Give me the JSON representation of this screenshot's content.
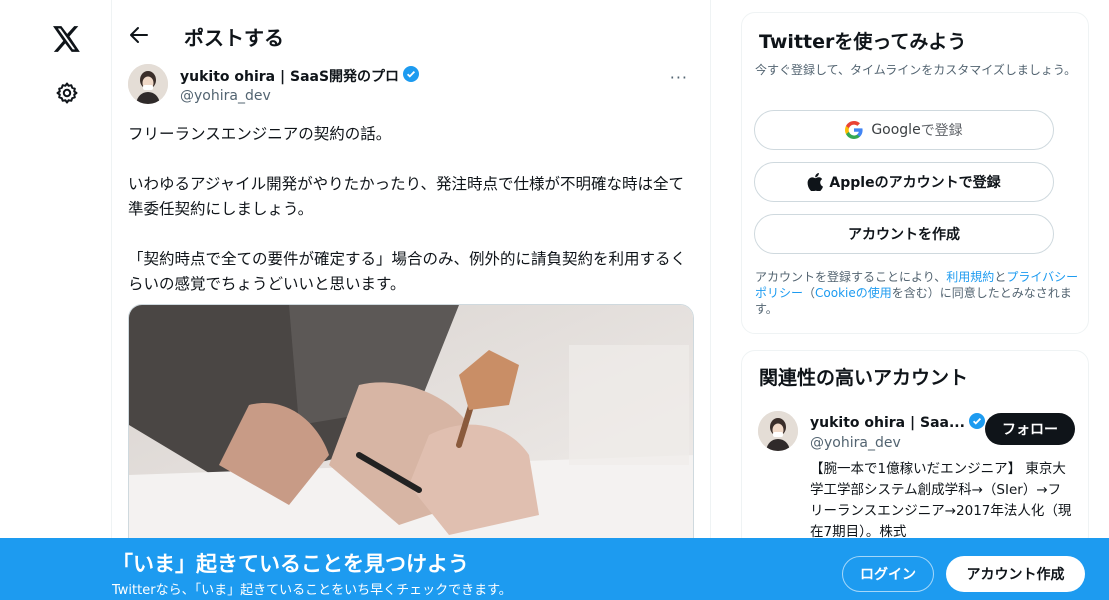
{
  "header": {
    "title": "ポストする"
  },
  "tweet": {
    "author_name": "yukito ohira | SaaS開発のプロ",
    "author_handle": "@yohira_dev",
    "more_label": "···",
    "text": "フリーランスエンジニアの契約の話。\n\nいわゆるアジャイル開発がやりたかったり、発注時点で仕様が不明確な時は全て準委任契約にしましょう。\n\n「契約時点で全ての要件が確定する」場合のみ、例外的に請負契約を利用するくらいの感覚でちょうどいいと思います。"
  },
  "signup_card": {
    "title": "Twitterを使ってみよう",
    "subtitle": "今すぐ登録して、タイムラインをカスタマイズしましょう。",
    "google_brand": "Google",
    "google_suffix": " で登録",
    "apple_label": "Appleのアカウントで登録",
    "create_label": "アカウントを作成",
    "terms_prefix": "アカウントを登録することにより、",
    "terms_link": "利用規約",
    "terms_and": "と",
    "privacy_link": "プライバシーポリシー",
    "terms_paren_open": "（",
    "cookie_link": "Cookieの使用",
    "terms_suffix": "を含む）に同意したとみなされます。"
  },
  "related": {
    "title": "関連性の高いアカウント",
    "name": "yukito ohira | Saa...",
    "handle": "@yohira_dev",
    "follow_label": "フォロー",
    "bio": "【腕一本で1億稼いだエンジニア】 東京大学工学部システム創成学科→（SIer）→フリーランスエンジニア→2017年法人化（現在7期目）。株式"
  },
  "bottom_bar": {
    "title": "「いま」起きていることを見つけよう",
    "subtitle": "Twitterなら、「いま」起きていることをいち早くチェックできます。",
    "login_label": "ログイン",
    "signup_label": "アカウント作成"
  },
  "colors": {
    "accent": "#1d9bf0",
    "text": "#0f1419",
    "secondary": "#536471"
  }
}
